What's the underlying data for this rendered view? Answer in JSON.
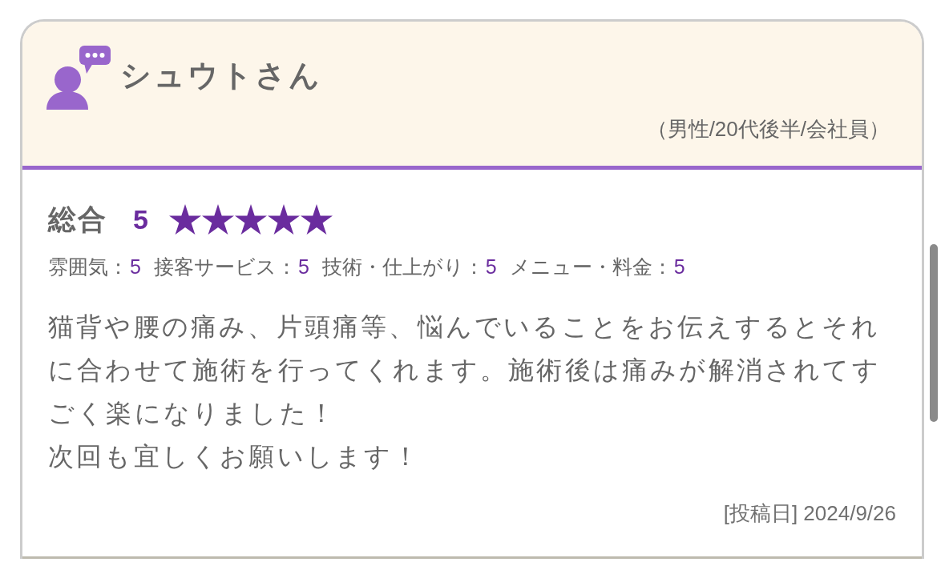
{
  "review": {
    "reviewer": {
      "name": "シュウトさん",
      "profile": "（男性/20代後半/会社員）"
    },
    "overall": {
      "label": "総合",
      "score": "5",
      "stars": 5
    },
    "sub_ratings": [
      {
        "label": "雰囲気：",
        "value": "5"
      },
      {
        "label": "接客サービス：",
        "value": "5"
      },
      {
        "label": "技術・仕上がり：",
        "value": "5"
      },
      {
        "label": "メニュー・料金：",
        "value": "5"
      }
    ],
    "comment": [
      "猫背や腰の痛み、片頭痛等、悩んでいることをお伝えするとそれに合わせて施術を行ってくれます。施術後は痛みが解消されてすごく楽になりました！",
      "次回も宜しくお願いします！"
    ],
    "posted": "[投稿日] 2024/9/26"
  }
}
